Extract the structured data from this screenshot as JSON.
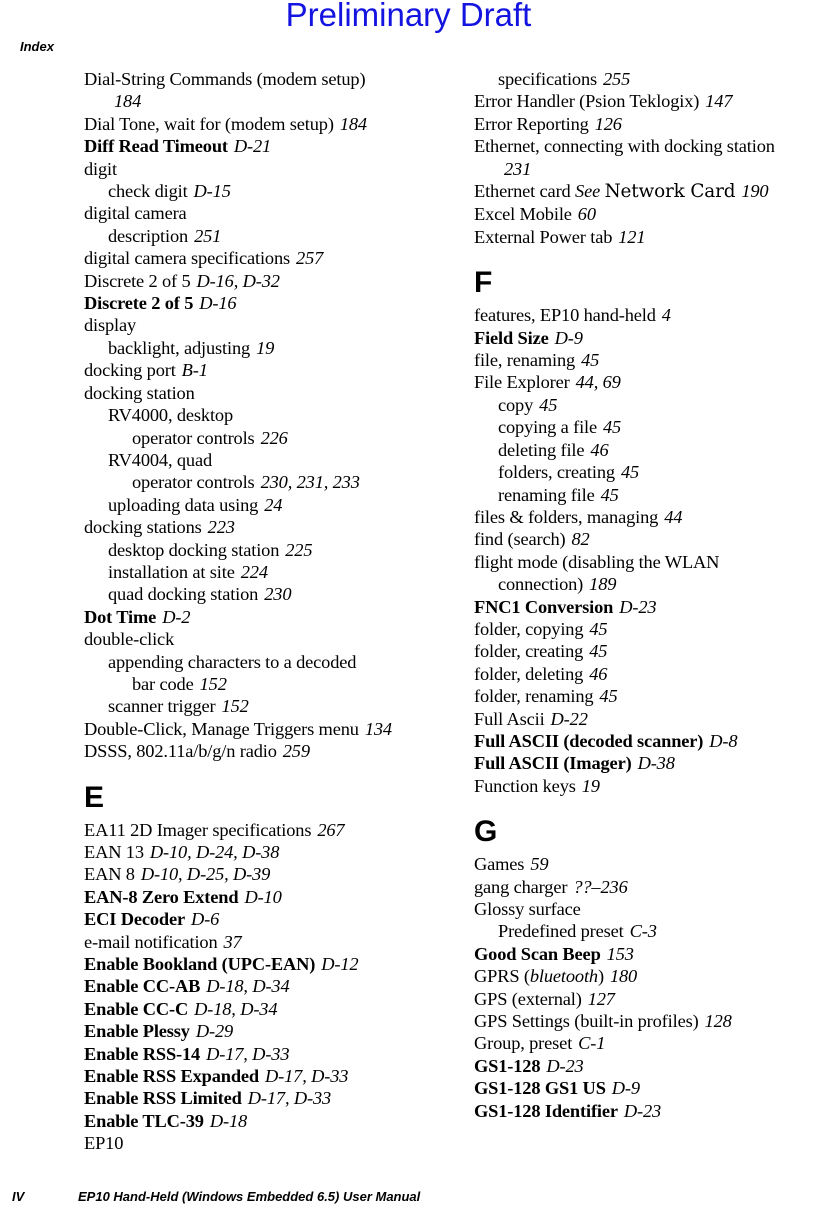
{
  "watermark": {
    "text": "Preliminary Draft",
    "color": "#1414e0"
  },
  "header": {
    "title": "Index"
  },
  "footer": {
    "page_number": "IV",
    "manual_title": "EP10 Hand-Held (Windows Embedded 6.5) User Manual"
  },
  "columns": {
    "left": [
      {
        "kind": "entry",
        "level": 0,
        "bold": false,
        "term": "Dial-String Commands (modem setup)",
        "pages": ""
      },
      {
        "kind": "entry",
        "level": 1,
        "bold": false,
        "term": "",
        "pages": "184"
      },
      {
        "kind": "entry",
        "level": 0,
        "bold": false,
        "term": "Dial Tone, wait for (modem setup)",
        "pages": "184"
      },
      {
        "kind": "entry",
        "level": 0,
        "bold": true,
        "term": "Diff Read Timeout",
        "pages": "D-21"
      },
      {
        "kind": "entry",
        "level": 0,
        "bold": false,
        "term": "digit",
        "pages": ""
      },
      {
        "kind": "entry",
        "level": 1,
        "bold": false,
        "term": "check digit",
        "pages": "D-15"
      },
      {
        "kind": "entry",
        "level": 0,
        "bold": false,
        "term": "digital camera",
        "pages": ""
      },
      {
        "kind": "entry",
        "level": 1,
        "bold": false,
        "term": "description",
        "pages": "251"
      },
      {
        "kind": "entry",
        "level": 0,
        "bold": false,
        "term": "digital camera specifications",
        "pages": "257"
      },
      {
        "kind": "entry",
        "level": 0,
        "bold": false,
        "term": "Discrete 2 of 5",
        "pages": "D-16, D-32"
      },
      {
        "kind": "entry",
        "level": 0,
        "bold": true,
        "term": "Discrete 2 of 5",
        "pages": "D-16"
      },
      {
        "kind": "entry",
        "level": 0,
        "bold": false,
        "term": "display",
        "pages": ""
      },
      {
        "kind": "entry",
        "level": 1,
        "bold": false,
        "term": "backlight, adjusting",
        "pages": "19"
      },
      {
        "kind": "entry",
        "level": 0,
        "bold": false,
        "term": "docking port",
        "pages": "B-1"
      },
      {
        "kind": "entry",
        "level": 0,
        "bold": false,
        "term": "docking station",
        "pages": ""
      },
      {
        "kind": "entry",
        "level": 1,
        "bold": false,
        "term": "RV4000, desktop",
        "pages": ""
      },
      {
        "kind": "entry",
        "level": 2,
        "bold": false,
        "term": "operator controls",
        "pages": "226"
      },
      {
        "kind": "entry",
        "level": 1,
        "bold": false,
        "term": "RV4004, quad",
        "pages": ""
      },
      {
        "kind": "entry",
        "level": 2,
        "bold": false,
        "term": "operator controls",
        "pages": "230, 231, 233"
      },
      {
        "kind": "entry",
        "level": 1,
        "bold": false,
        "term": "uploading data using",
        "pages": "24"
      },
      {
        "kind": "entry",
        "level": 0,
        "bold": false,
        "term": "docking stations",
        "pages": "223"
      },
      {
        "kind": "entry",
        "level": 1,
        "bold": false,
        "term": "desktop docking station",
        "pages": "225"
      },
      {
        "kind": "entry",
        "level": 1,
        "bold": false,
        "term": "installation at site",
        "pages": "224"
      },
      {
        "kind": "entry",
        "level": 1,
        "bold": false,
        "term": "quad docking station",
        "pages": "230"
      },
      {
        "kind": "entry",
        "level": 0,
        "bold": true,
        "term": "Dot Time",
        "pages": "D-2"
      },
      {
        "kind": "entry",
        "level": 0,
        "bold": false,
        "term": "double-click",
        "pages": ""
      },
      {
        "kind": "entry",
        "level": 1,
        "bold": false,
        "term": "appending characters to a decoded",
        "pages": ""
      },
      {
        "kind": "entry",
        "level": 2,
        "bold": false,
        "term": "bar code",
        "pages": "152"
      },
      {
        "kind": "entry",
        "level": 1,
        "bold": false,
        "term": "scanner trigger",
        "pages": "152"
      },
      {
        "kind": "entry",
        "level": 0,
        "bold": false,
        "term": "Double-Click, Manage Triggers menu",
        "pages": "134"
      },
      {
        "kind": "entry",
        "level": 0,
        "bold": false,
        "term": "DSSS, 802.11a/b/g/n radio",
        "pages": "259"
      },
      {
        "kind": "letter",
        "letter": "E"
      },
      {
        "kind": "entry",
        "level": 0,
        "bold": false,
        "term": "EA11 2D Imager specifications",
        "pages": "267"
      },
      {
        "kind": "entry",
        "level": 0,
        "bold": false,
        "term": "EAN 13",
        "pages": "D-10, D-24, D-38"
      },
      {
        "kind": "entry",
        "level": 0,
        "bold": false,
        "term": "EAN 8",
        "pages": "D-10, D-25, D-39"
      },
      {
        "kind": "entry",
        "level": 0,
        "bold": true,
        "term": "EAN-8 Zero Extend",
        "pages": "D-10"
      },
      {
        "kind": "entry",
        "level": 0,
        "bold": true,
        "term": "ECI Decoder",
        "pages": "D-6"
      },
      {
        "kind": "entry",
        "level": 0,
        "bold": false,
        "term": "e-mail notification",
        "pages": "37"
      },
      {
        "kind": "entry",
        "level": 0,
        "bold": true,
        "term": "Enable Bookland (UPC-EAN)",
        "pages": "D-12"
      },
      {
        "kind": "entry",
        "level": 0,
        "bold": true,
        "term": "Enable CC-AB",
        "pages": "D-18, D-34"
      },
      {
        "kind": "entry",
        "level": 0,
        "bold": true,
        "term": "Enable CC-C",
        "pages": "D-18, D-34"
      },
      {
        "kind": "entry",
        "level": 0,
        "bold": true,
        "term": "Enable Plessy",
        "pages": "D-29"
      },
      {
        "kind": "entry",
        "level": 0,
        "bold": true,
        "term": "Enable RSS-14",
        "pages": "D-17, D-33"
      },
      {
        "kind": "entry",
        "level": 0,
        "bold": true,
        "term": "Enable RSS Expanded",
        "pages": "D-17, D-33"
      },
      {
        "kind": "entry",
        "level": 0,
        "bold": true,
        "term": "Enable RSS Limited",
        "pages": "D-17, D-33"
      },
      {
        "kind": "entry",
        "level": 0,
        "bold": true,
        "term": "Enable TLC-39",
        "pages": "D-18"
      },
      {
        "kind": "entry",
        "level": 0,
        "bold": false,
        "term": "EP10",
        "pages": ""
      }
    ],
    "right": [
      {
        "kind": "entry",
        "level": 1,
        "bold": false,
        "term": "specifications",
        "pages": "255"
      },
      {
        "kind": "entry",
        "level": 0,
        "bold": false,
        "term": "Error Handler (Psion Teklogix)",
        "pages": "147"
      },
      {
        "kind": "entry",
        "level": 0,
        "bold": false,
        "term": "Error Reporting",
        "pages": "126"
      },
      {
        "kind": "entry",
        "level": 0,
        "bold": false,
        "term": "Ethernet, connecting with docking station",
        "pages": ""
      },
      {
        "kind": "entry",
        "level": 1,
        "bold": false,
        "term": "",
        "pages": "231"
      },
      {
        "kind": "entry-see",
        "level": 0,
        "bold": false,
        "term": "Ethernet card",
        "see": "See",
        "see_target": "Network Card",
        "pages": "190"
      },
      {
        "kind": "entry",
        "level": 0,
        "bold": false,
        "term": "Excel Mobile",
        "pages": "60"
      },
      {
        "kind": "entry",
        "level": 0,
        "bold": false,
        "term": "External Power tab",
        "pages": "121"
      },
      {
        "kind": "letter",
        "letter": "F"
      },
      {
        "kind": "entry",
        "level": 0,
        "bold": false,
        "term": "features, EP10 hand-held",
        "pages": "4"
      },
      {
        "kind": "entry",
        "level": 0,
        "bold": true,
        "term": "Field Size",
        "pages": "D-9"
      },
      {
        "kind": "entry",
        "level": 0,
        "bold": false,
        "term": "file, renaming",
        "pages": "45"
      },
      {
        "kind": "entry",
        "level": 0,
        "bold": false,
        "term": "File Explorer",
        "pages": "44, 69"
      },
      {
        "kind": "entry",
        "level": 1,
        "bold": false,
        "term": "copy",
        "pages": "45"
      },
      {
        "kind": "entry",
        "level": 1,
        "bold": false,
        "term": "copying a file",
        "pages": "45"
      },
      {
        "kind": "entry",
        "level": 1,
        "bold": false,
        "term": "deleting file",
        "pages": "46"
      },
      {
        "kind": "entry",
        "level": 1,
        "bold": false,
        "term": "folders, creating",
        "pages": "45"
      },
      {
        "kind": "entry",
        "level": 1,
        "bold": false,
        "term": "renaming file",
        "pages": "45"
      },
      {
        "kind": "entry",
        "level": 0,
        "bold": false,
        "term": "files & folders, managing",
        "pages": "44"
      },
      {
        "kind": "entry",
        "level": 0,
        "bold": false,
        "term": "find (search)",
        "pages": "82"
      },
      {
        "kind": "entry",
        "level": 0,
        "bold": false,
        "term": "flight mode (disabling the WLAN",
        "pages": ""
      },
      {
        "kind": "entry",
        "level": 1,
        "bold": false,
        "term": "connection)",
        "pages": "189"
      },
      {
        "kind": "entry",
        "level": 0,
        "bold": true,
        "term": "FNC1 Conversion",
        "pages": "D-23"
      },
      {
        "kind": "entry",
        "level": 0,
        "bold": false,
        "term": "folder, copying",
        "pages": "45"
      },
      {
        "kind": "entry",
        "level": 0,
        "bold": false,
        "term": "folder, creating",
        "pages": "45"
      },
      {
        "kind": "entry",
        "level": 0,
        "bold": false,
        "term": "folder, deleting",
        "pages": "46"
      },
      {
        "kind": "entry",
        "level": 0,
        "bold": false,
        "term": "folder, renaming",
        "pages": "45"
      },
      {
        "kind": "entry",
        "level": 0,
        "bold": false,
        "term": "Full Ascii",
        "pages": "D-22"
      },
      {
        "kind": "entry",
        "level": 0,
        "bold": true,
        "term": "Full ASCII (decoded scanner)",
        "pages": "D-8"
      },
      {
        "kind": "entry",
        "level": 0,
        "bold": true,
        "term": "Full ASCII (Imager)",
        "pages": "D-38"
      },
      {
        "kind": "entry",
        "level": 0,
        "bold": false,
        "term": "Function keys",
        "pages": "19"
      },
      {
        "kind": "letter",
        "letter": "G"
      },
      {
        "kind": "entry",
        "level": 0,
        "bold": false,
        "term": "Games",
        "pages": "59"
      },
      {
        "kind": "entry",
        "level": 0,
        "bold": false,
        "term": "gang charger",
        "pages": "??–236"
      },
      {
        "kind": "entry",
        "level": 0,
        "bold": false,
        "term": "Glossy surface",
        "pages": ""
      },
      {
        "kind": "entry",
        "level": 1,
        "bold": false,
        "term": "Predefined preset",
        "pages": "C-3"
      },
      {
        "kind": "entry",
        "level": 0,
        "bold": true,
        "term": "Good Scan Beep",
        "pages": "153"
      },
      {
        "kind": "entry-italic-paren",
        "level": 0,
        "bold": false,
        "term": "GPRS (",
        "term_italic": "bluetooth",
        "term_tail": ")",
        "pages": "180"
      },
      {
        "kind": "entry",
        "level": 0,
        "bold": false,
        "term": "GPS (external)",
        "pages": "127"
      },
      {
        "kind": "entry",
        "level": 0,
        "bold": false,
        "term": "GPS Settings (built-in profiles)",
        "pages": "128"
      },
      {
        "kind": "entry",
        "level": 0,
        "bold": false,
        "term": "Group, preset",
        "pages": "C-1"
      },
      {
        "kind": "entry",
        "level": 0,
        "bold": true,
        "term": "GS1-128",
        "pages": "D-23"
      },
      {
        "kind": "entry",
        "level": 0,
        "bold": true,
        "term": "GS1-128 GS1 US",
        "pages": "D-9"
      },
      {
        "kind": "entry",
        "level": 0,
        "bold": true,
        "term": "GS1-128 Identifier",
        "pages": "D-23"
      }
    ]
  }
}
